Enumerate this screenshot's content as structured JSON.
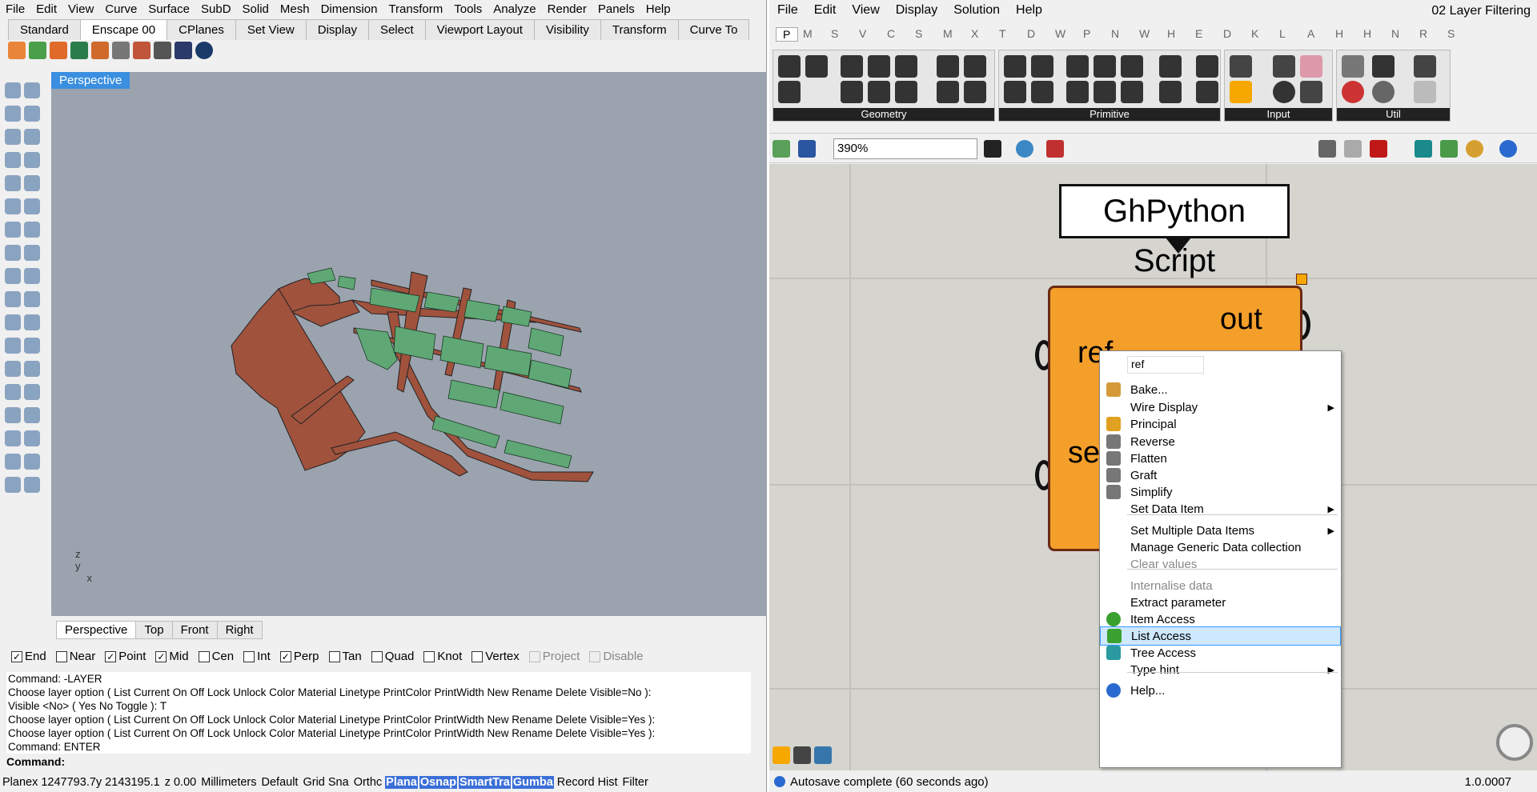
{
  "rhino": {
    "menu": [
      "File",
      "Edit",
      "View",
      "Curve",
      "Surface",
      "SubD",
      "Solid",
      "Mesh",
      "Dimension",
      "Transform",
      "Tools",
      "Analyze",
      "Render",
      "Panels",
      "Help"
    ],
    "tabs": [
      "Standard",
      "Enscape 00",
      "CPlanes",
      "Set View",
      "Display",
      "Select",
      "Viewport Layout",
      "Visibility",
      "Transform",
      "Curve To"
    ],
    "active_tab": "Enscape 00",
    "viewport_label": "Perspective",
    "view_tabs": [
      "Perspective",
      "Top",
      "Front",
      "Right"
    ],
    "osnap": [
      {
        "label": "End",
        "checked": true
      },
      {
        "label": "Near",
        "checked": false
      },
      {
        "label": "Point",
        "checked": true
      },
      {
        "label": "Mid",
        "checked": true
      },
      {
        "label": "Cen",
        "checked": false
      },
      {
        "label": "Int",
        "checked": false
      },
      {
        "label": "Perp",
        "checked": true
      },
      {
        "label": "Tan",
        "checked": false
      },
      {
        "label": "Quad",
        "checked": false
      },
      {
        "label": "Knot",
        "checked": false
      },
      {
        "label": "Vertex",
        "checked": false
      },
      {
        "label": "Project",
        "checked": false,
        "disabled": true
      },
      {
        "label": "Disable",
        "checked": false,
        "disabled": true
      }
    ],
    "command_history": [
      "Command: -LAYER",
      "Choose layer option ( List  Current  On  Off  Lock  Unlock  Color  Material  Linetype  PrintColor  PrintWidth  New  Rename  Delete  Visible=No ):",
      "Visible <No> ( Yes  No  Toggle ): T",
      "Choose layer option ( List  Current  On  Off  Lock  Unlock  Color  Material  Linetype  PrintColor  PrintWidth  New  Rename  Delete  Visible=Yes ):",
      "Choose layer option ( List  Current  On  Off  Lock  Unlock  Color  Material  Linetype  PrintColor  PrintWidth  New  Rename  Delete  Visible=Yes ):",
      "Command: ENTER"
    ],
    "command_prompt": "Command:",
    "status": {
      "cplane": "Planex 1247793.7y 2143195.1",
      "z": "z 0.00",
      "units": "Millimeters",
      "layer": "Default",
      "grid": "Grid Sna",
      "ortho": "Orthc",
      "planar": "Plana",
      "osnap": "Osnap",
      "smarttrack": "SmartTra",
      "gumball": "Gumba",
      "record": "Record Hist",
      "filter": "Filter"
    }
  },
  "gh": {
    "menu": [
      "File",
      "Edit",
      "View",
      "Display",
      "Solution",
      "Help"
    ],
    "title": "02 Layer Filtering",
    "tabs": [
      "P",
      "M",
      "S",
      "V",
      "C",
      "S",
      "M",
      "X",
      "T",
      "D",
      "W",
      "P",
      "N",
      "W",
      "H",
      "E",
      "D",
      "K",
      "L",
      "A",
      "H",
      "H",
      "N",
      "R",
      "S"
    ],
    "panels": [
      "Geometry",
      "Primitive",
      "Input",
      "Util"
    ],
    "zoom": "390%",
    "bubble": "GhPython Script",
    "component": {
      "out": "out",
      "ref": "ref",
      "se": "se"
    },
    "context_menu": {
      "name_value": "ref",
      "items": [
        {
          "label": "Bake...",
          "icon": "bake-icon"
        },
        {
          "label": "Wire Display",
          "sub": true
        },
        {
          "label": "Principal",
          "icon": "principal-icon"
        },
        {
          "label": "Reverse",
          "icon": "reverse-icon"
        },
        {
          "label": "Flatten",
          "icon": "flatten-icon"
        },
        {
          "label": "Graft",
          "icon": "graft-icon"
        },
        {
          "label": "Simplify",
          "icon": "simplify-icon"
        },
        {
          "label": "Set Data Item",
          "sub": true
        },
        {
          "label": "Set Multiple Data Items",
          "sub": true
        },
        {
          "label": "Manage Generic Data collection"
        },
        {
          "label": "Clear values",
          "disabled": true
        },
        {
          "label": "Internalise data",
          "disabled": true
        },
        {
          "label": "Extract parameter"
        },
        {
          "label": "Item Access",
          "icon": "item-access-icon"
        },
        {
          "label": "List Access",
          "icon": "list-access-icon",
          "selected": true
        },
        {
          "label": "Tree Access",
          "icon": "tree-access-icon"
        },
        {
          "label": "Type hint",
          "sub": true
        },
        {
          "label": "Help...",
          "icon": "help-icon"
        }
      ]
    },
    "status": "Autosave complete (60 seconds ago)",
    "version": "1.0.0007"
  }
}
